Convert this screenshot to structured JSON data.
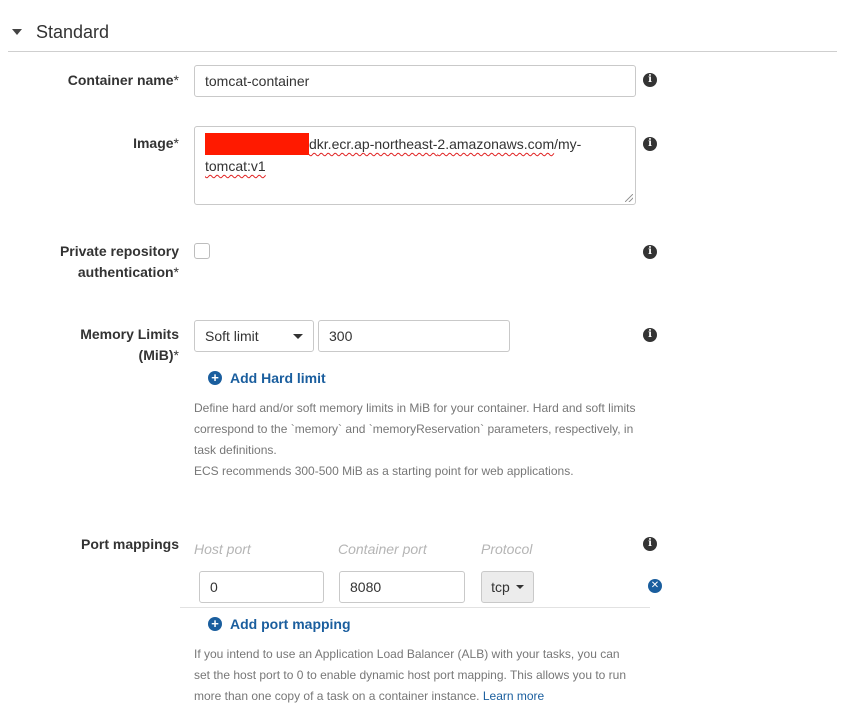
{
  "section": {
    "title": "Standard"
  },
  "container_name": {
    "label": "Container name",
    "required": "*",
    "value": "tomcat-container"
  },
  "image": {
    "label": "Image",
    "required": "*",
    "line1_a": "dkr.ecr.ap-northeast-",
    "line1_b": "2.amazonaws.com",
    "line1_c": "/my-",
    "line2": "tomcat:v1"
  },
  "private_repo": {
    "label_line1": "Private repository",
    "label_line2": "authentication",
    "required": "*"
  },
  "memory": {
    "label_line1": "Memory Limits",
    "label_line2": "(MiB)",
    "required": "*",
    "select_value": "Soft limit",
    "value": "300",
    "add_hard_limit": "Add Hard limit",
    "help_line1": "Define hard and/or soft memory limits in MiB for your container. Hard and soft limits",
    "help_line2": "correspond to the `memory` and `memoryReservation` parameters, respectively, in",
    "help_line3": "task definitions.",
    "help_line4": "ECS recommends 300-500 MiB as a starting point for web applications."
  },
  "port_mappings": {
    "label": "Port mappings",
    "col_host": "Host port",
    "col_container": "Container port",
    "col_protocol": "Protocol",
    "host_value": "0",
    "container_value": "8080",
    "protocol_value": "tcp",
    "add_port_mapping": "Add port mapping",
    "help_line1": "If you intend to use an Application Load Balancer (ALB) with your tasks, you can",
    "help_line2": "set the host port to 0 to enable dynamic host port mapping. This allows you to run",
    "help_line3": "more than one copy of a task on a container instance. ",
    "learn_more": "Learn more"
  },
  "icons": {
    "info": "info-icon",
    "plus": "plus-circle-icon",
    "remove": "remove-circle-icon",
    "caret": "caret-down-icon"
  },
  "colors": {
    "link": "#1a5e9e",
    "redaction": "#ff1a00",
    "border": "#c9c9c9"
  }
}
